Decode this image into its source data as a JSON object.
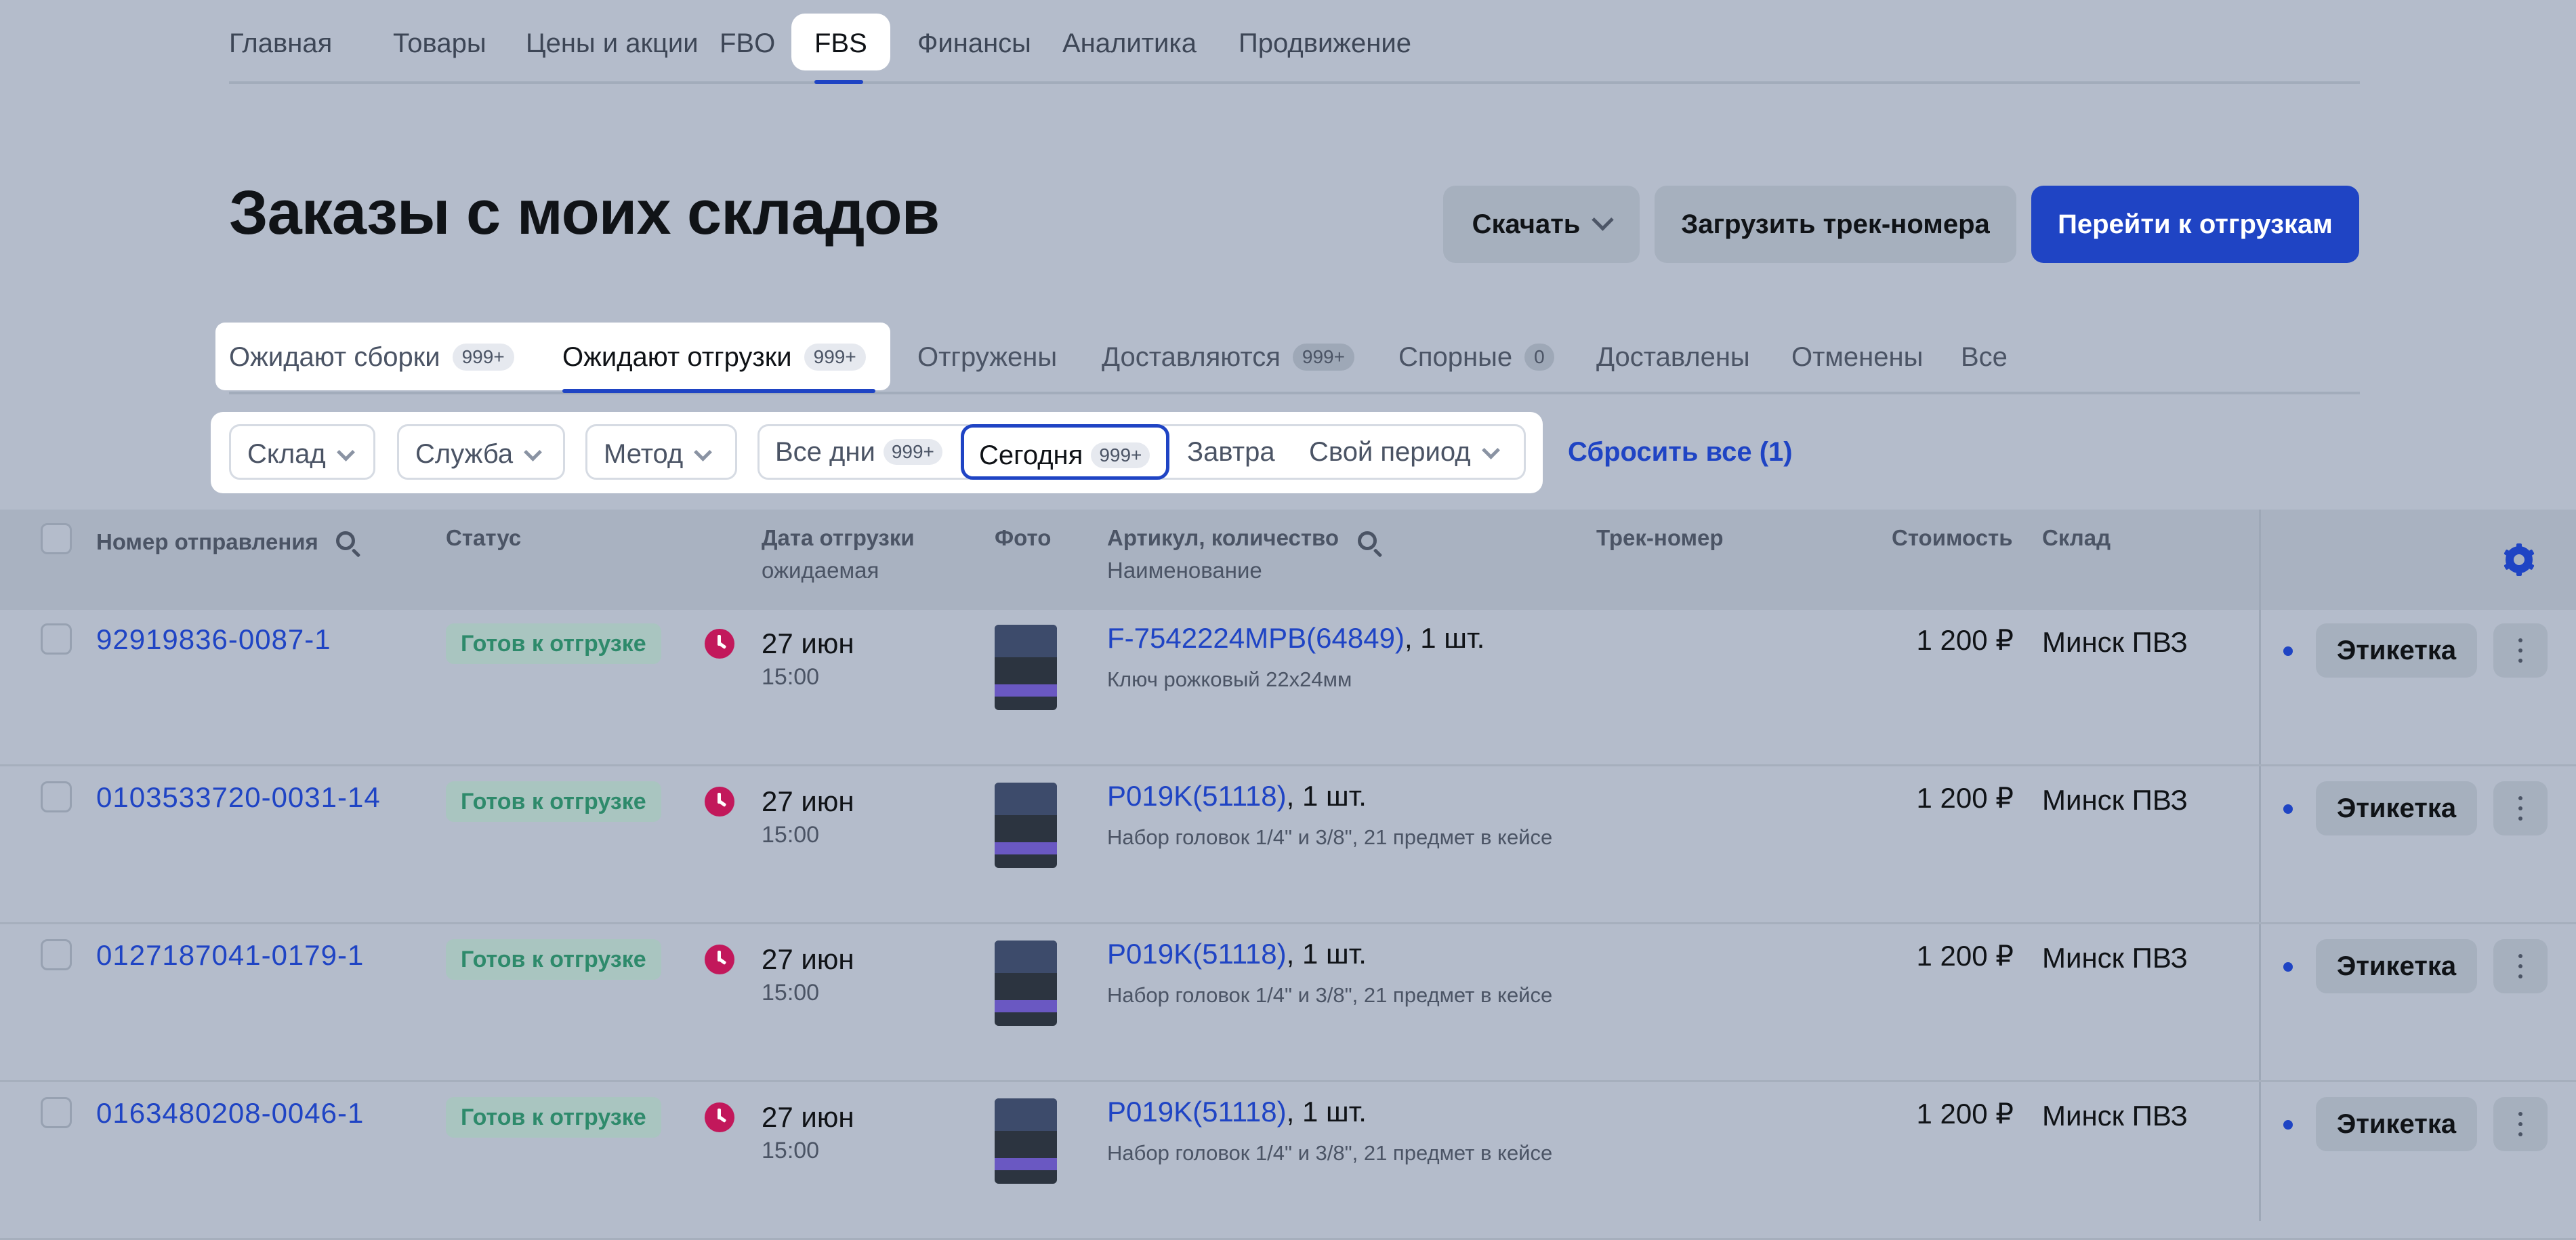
{
  "topnav": {
    "items": [
      "Главная",
      "Товары",
      "Цены и акции",
      "FBO",
      "FBS",
      "Финансы",
      "Аналитика",
      "Продвижение"
    ],
    "active": "FBS"
  },
  "page_title": "Заказы с моих складов",
  "actions": {
    "download": "Скачать",
    "upload_tracks": "Загрузить трек-номера",
    "go_shipments": "Перейти к отгрузкам"
  },
  "status_tabs": [
    {
      "label": "Ожидают сборки",
      "badge": "999+"
    },
    {
      "label": "Ожидают отгрузки",
      "badge": "999+"
    },
    {
      "label": "Отгружены",
      "badge": ""
    },
    {
      "label": "Доставляются",
      "badge": "999+"
    },
    {
      "label": "Спорные",
      "badge": "0"
    },
    {
      "label": "Доставлены",
      "badge": ""
    },
    {
      "label": "Отменены",
      "badge": ""
    },
    {
      "label": "Все",
      "badge": ""
    }
  ],
  "filters": {
    "warehouse": "Склад",
    "service": "Служба",
    "method": "Метод",
    "all_days": "Все дни",
    "all_days_badge": "999+",
    "today": "Сегодня",
    "today_badge": "999+",
    "tomorrow": "Завтра",
    "custom_period": "Свой период",
    "reset": "Сбросить все (1)"
  },
  "table": {
    "headers": {
      "order": "Номер отправления",
      "status": "Статус",
      "ship_date": "Дата отгрузки",
      "ship_date_sub": "ожидаемая",
      "photo": "Фото",
      "sku": "Артикул, количество",
      "sku_sub": "Наименование",
      "track": "Трек-номер",
      "price": "Стоимость",
      "warehouse": "Склад"
    },
    "rows": [
      {
        "order": "92919836-0087-1",
        "status": "Готов к отгрузке",
        "date": "27 июн",
        "time": "15:00",
        "sku": "F-7542224MPB(64849)",
        "qty": ", 1 шт.",
        "name": "Ключ рожковый 22х24мм",
        "price": "1 200 ₽",
        "warehouse": "Минск ПВЗ",
        "label_btn": "Этикетка"
      },
      {
        "order": "0103533720-0031-14",
        "status": "Готов к отгрузке",
        "date": "27 июн",
        "time": "15:00",
        "sku": "P019K(51118)",
        "qty": ", 1 шт.",
        "name": "Набор головок 1/4\" и 3/8\", 21 предмет в кейсе",
        "price": "1 200 ₽",
        "warehouse": "Минск ПВЗ",
        "label_btn": "Этикетка"
      },
      {
        "order": "0127187041-0179-1",
        "status": "Готов к отгрузке",
        "date": "27 июн",
        "time": "15:00",
        "sku": "P019K(51118)",
        "qty": ", 1 шт.",
        "name": "Набор головок 1/4\" и 3/8\", 21 предмет в кейсе",
        "price": "1 200 ₽",
        "warehouse": "Минск ПВЗ",
        "label_btn": "Этикетка"
      },
      {
        "order": "0163480208-0046-1",
        "status": "Готов к отгрузке",
        "date": "27 июн",
        "time": "15:00",
        "sku": "P019K(51118)",
        "qty": ", 1 шт.",
        "name": "Набор головок 1/4\" и 3/8\", 21 предмет в кейсе",
        "price": "1 200 ₽",
        "warehouse": "Минск ПВЗ",
        "label_btn": "Этикетка"
      }
    ]
  },
  "colors": {
    "accent": "#1f44c4",
    "status": "#2e8a6b",
    "clock": "#c2185b"
  }
}
